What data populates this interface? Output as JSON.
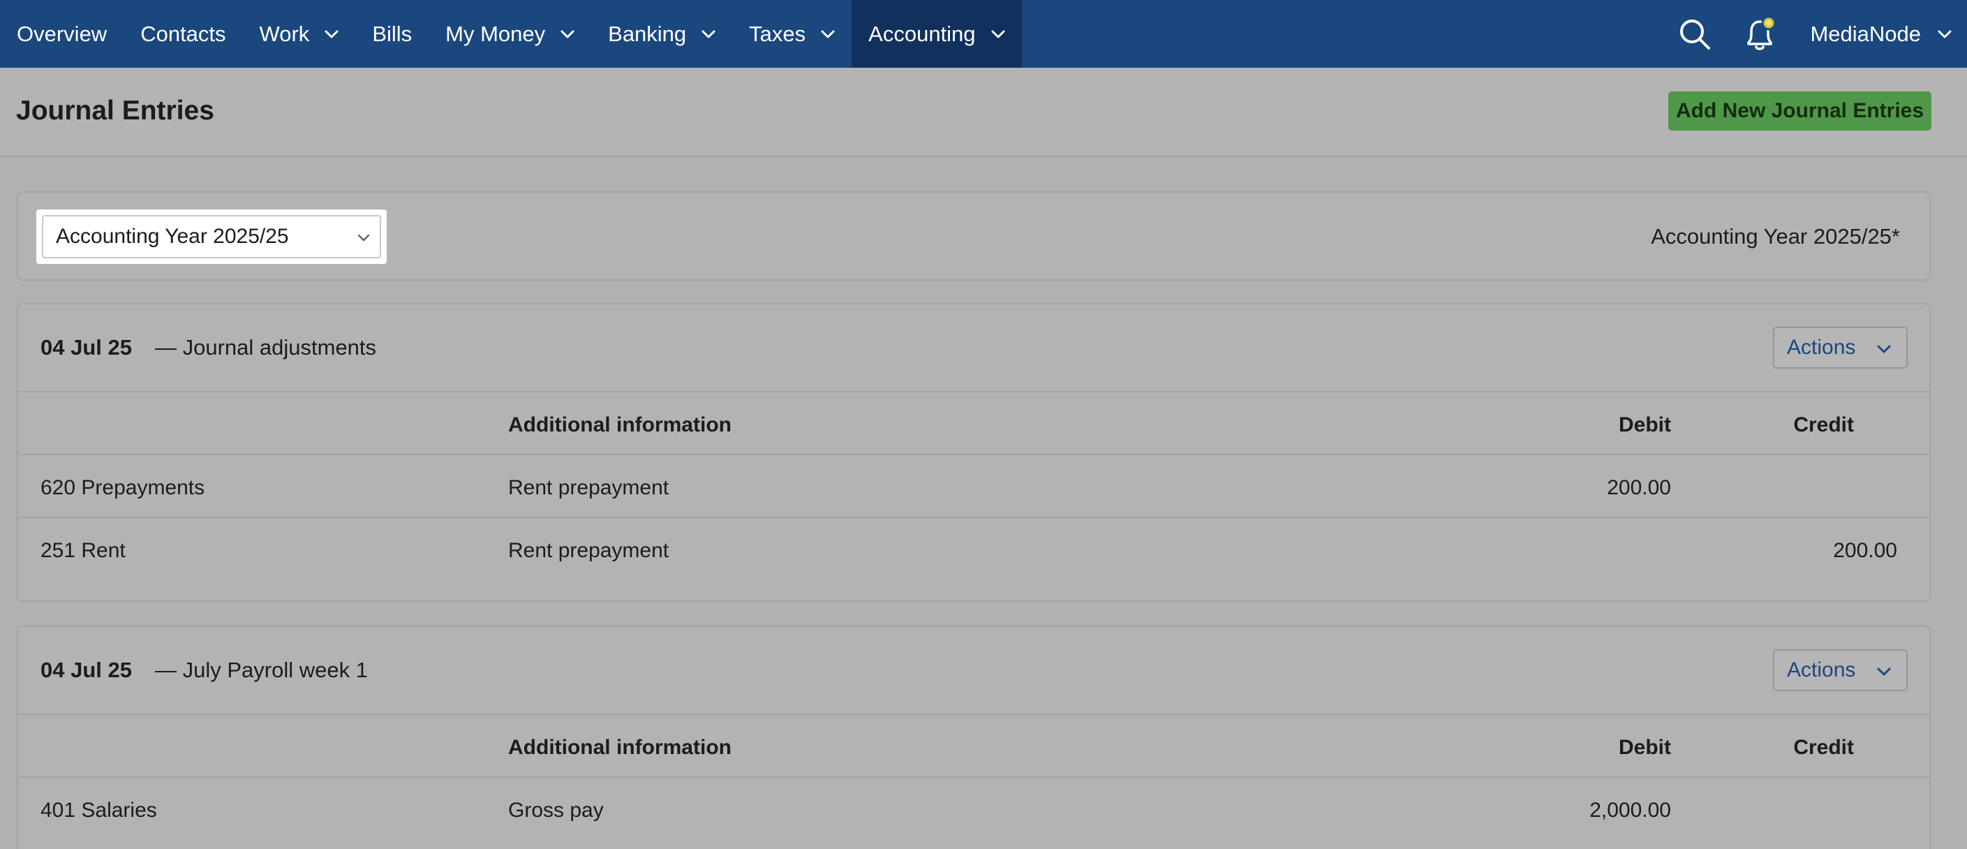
{
  "nav": {
    "items": [
      {
        "label": "Overview",
        "has_menu": false
      },
      {
        "label": "Contacts",
        "has_menu": false
      },
      {
        "label": "Work",
        "has_menu": true
      },
      {
        "label": "Bills",
        "has_menu": false
      },
      {
        "label": "My Money",
        "has_menu": true
      },
      {
        "label": "Banking",
        "has_menu": true
      },
      {
        "label": "Taxes",
        "has_menu": true
      },
      {
        "label": "Accounting",
        "has_menu": true,
        "active": true
      }
    ],
    "account_name": "MediaNode",
    "icons": [
      "search-icon",
      "bell-icon"
    ]
  },
  "page": {
    "title": "Journal Entries",
    "add_button": "Add New Journal Entries"
  },
  "filter": {
    "selected_year": "Accounting Year 2025/25",
    "year_label": "Accounting Year 2025/25*"
  },
  "journals": [
    {
      "date": "04 Jul 25",
      "description": "— Journal adjustments",
      "actions_label": "Actions",
      "headers": {
        "account": "",
        "info": "Additional information",
        "debit": "Debit",
        "credit": "Credit"
      },
      "rows": [
        {
          "account": "620 Prepayments",
          "info": "Rent prepayment",
          "debit": "200.00",
          "credit": ""
        },
        {
          "account": "251 Rent",
          "info": "Rent prepayment",
          "debit": "",
          "credit": "200.00"
        }
      ]
    },
    {
      "date": "04 Jul 25",
      "description": "— July Payroll week 1",
      "actions_label": "Actions",
      "headers": {
        "account": "",
        "info": "Additional information",
        "debit": "Debit",
        "credit": "Credit"
      },
      "rows": [
        {
          "account": "401 Salaries",
          "info": "Gross pay",
          "debit": "2,000.00",
          "credit": ""
        }
      ]
    }
  ],
  "colors": {
    "nav_bg": "#1b477f",
    "nav_active_bg": "#11305e",
    "add_button_bg": "#4f9849",
    "actions_text": "#1b477f"
  }
}
